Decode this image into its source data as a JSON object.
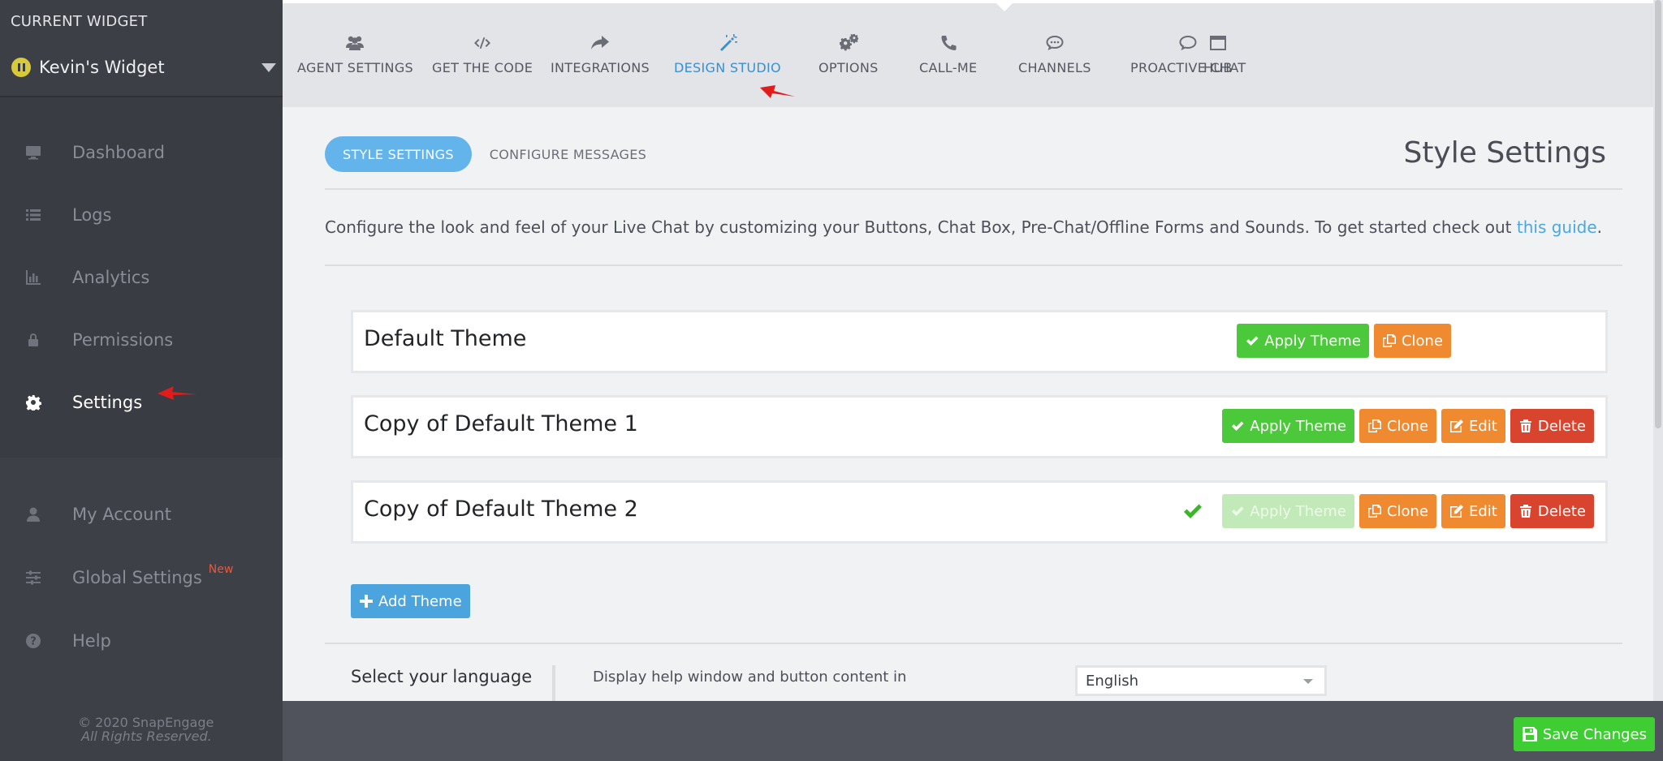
{
  "sidebar": {
    "current_widget_label": "CURRENT WIDGET",
    "widget_name": "Kevin's Widget",
    "items": [
      {
        "label": "Dashboard",
        "icon": "monitor-icon"
      },
      {
        "label": "Logs",
        "icon": "list-icon"
      },
      {
        "label": "Analytics",
        "icon": "bar-chart-icon"
      },
      {
        "label": "Permissions",
        "icon": "lock-icon"
      },
      {
        "label": "Settings",
        "icon": "gear-icon",
        "active": true
      }
    ],
    "lower_items": [
      {
        "label": "My Account",
        "icon": "user-icon"
      },
      {
        "label": "Global Settings",
        "icon": "sliders-icon",
        "badge": "New"
      },
      {
        "label": "Help",
        "icon": "question-icon"
      }
    ],
    "copyright": "© 2020 SnapEngage",
    "rights": "All Rights Reserved."
  },
  "tabs": [
    {
      "label": "AGENT SETTINGS",
      "icon": "users-icon"
    },
    {
      "label": "GET THE CODE",
      "icon": "code-icon"
    },
    {
      "label": "INTEGRATIONS",
      "icon": "share-icon"
    },
    {
      "label": "DESIGN STUDIO",
      "icon": "magic-wand-icon",
      "active": true
    },
    {
      "label": "OPTIONS",
      "icon": "gears-icon"
    },
    {
      "label": "CALL-ME",
      "icon": "phone-icon"
    },
    {
      "label": "CHANNELS",
      "icon": "chat-dots-icon"
    },
    {
      "label": "PROACTIVE CHAT",
      "icon": "chat-bubble-icon"
    },
    {
      "label": "HUB",
      "icon": "window-icon"
    }
  ],
  "subtabs": {
    "style_settings": "STYLE SETTINGS",
    "configure_messages": "CONFIGURE MESSAGES"
  },
  "page_title": "Style Settings",
  "description": {
    "text": "Configure the look and feel of your Live Chat by customizing your Buttons, Chat Box, Pre-Chat/Offline Forms and Sounds. To get started check out ",
    "link": "this guide",
    "end": "."
  },
  "themes": [
    {
      "name": "Default Theme",
      "applied": false
    },
    {
      "name": "Copy of Default Theme 1",
      "applied": false
    },
    {
      "name": "Copy of Default Theme 2",
      "applied": true
    }
  ],
  "buttons": {
    "apply": "Apply Theme",
    "clone": "Clone",
    "edit": "Edit",
    "delete": "Delete",
    "add_theme": "Add Theme",
    "save": "Save Changes"
  },
  "language": {
    "label": "Select your language",
    "help": "Display help window and button content in",
    "selected": "English"
  },
  "colors": {
    "accent": "#62b4ea",
    "apply_green": "#4cc93a",
    "clone_orange": "#ef8a30",
    "delete_red": "#d9442e",
    "sidebar_bg": "#3a3c44"
  }
}
